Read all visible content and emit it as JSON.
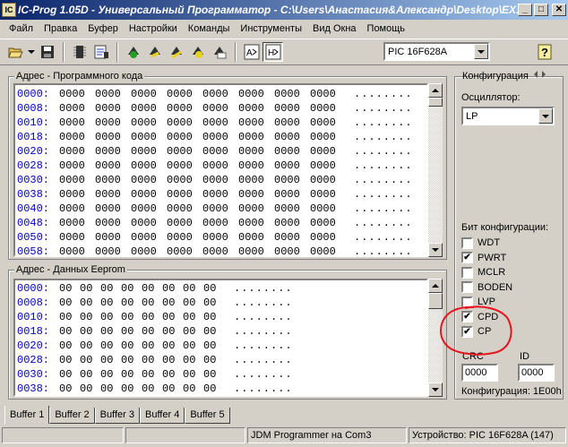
{
  "window": {
    "app_icon_text": "IC",
    "title": "IC-Prog 1.05D - Универсальный Программатор - C:\\Users\\Анастасия&Александр\\Desktop\\EX..."
  },
  "menu": [
    "Файл",
    "Правка",
    "Буфер",
    "Настройки",
    "Команды",
    "Инструменты",
    "Вид Окна",
    "Помощь"
  ],
  "toolbar": {
    "icons": [
      "open-icon",
      "save-icon",
      "chip-icon",
      "chip-config-icon",
      "read-icon",
      "program-icon",
      "erase-icon",
      "verify-icon",
      "blank-check-icon",
      "view-assembler-icon",
      "view-hex-icon",
      "help-icon"
    ],
    "device": "PIC 16F628A"
  },
  "program_memory": {
    "label": "Адрес - Программного кода",
    "rows": [
      {
        "addr": "0000:",
        "cells": [
          "0000",
          "0000",
          "0000",
          "0000",
          "0000",
          "0000",
          "0000",
          "0000"
        ],
        "ascii": "........"
      },
      {
        "addr": "0008:",
        "cells": [
          "0000",
          "0000",
          "0000",
          "0000",
          "0000",
          "0000",
          "0000",
          "0000"
        ],
        "ascii": "........"
      },
      {
        "addr": "0010:",
        "cells": [
          "0000",
          "0000",
          "0000",
          "0000",
          "0000",
          "0000",
          "0000",
          "0000"
        ],
        "ascii": "........"
      },
      {
        "addr": "0018:",
        "cells": [
          "0000",
          "0000",
          "0000",
          "0000",
          "0000",
          "0000",
          "0000",
          "0000"
        ],
        "ascii": "........"
      },
      {
        "addr": "0020:",
        "cells": [
          "0000",
          "0000",
          "0000",
          "0000",
          "0000",
          "0000",
          "0000",
          "0000"
        ],
        "ascii": "........"
      },
      {
        "addr": "0028:",
        "cells": [
          "0000",
          "0000",
          "0000",
          "0000",
          "0000",
          "0000",
          "0000",
          "0000"
        ],
        "ascii": "........"
      },
      {
        "addr": "0030:",
        "cells": [
          "0000",
          "0000",
          "0000",
          "0000",
          "0000",
          "0000",
          "0000",
          "0000"
        ],
        "ascii": "........"
      },
      {
        "addr": "0038:",
        "cells": [
          "0000",
          "0000",
          "0000",
          "0000",
          "0000",
          "0000",
          "0000",
          "0000"
        ],
        "ascii": "........"
      },
      {
        "addr": "0040:",
        "cells": [
          "0000",
          "0000",
          "0000",
          "0000",
          "0000",
          "0000",
          "0000",
          "0000"
        ],
        "ascii": "........"
      },
      {
        "addr": "0048:",
        "cells": [
          "0000",
          "0000",
          "0000",
          "0000",
          "0000",
          "0000",
          "0000",
          "0000"
        ],
        "ascii": "........"
      },
      {
        "addr": "0050:",
        "cells": [
          "0000",
          "0000",
          "0000",
          "0000",
          "0000",
          "0000",
          "0000",
          "0000"
        ],
        "ascii": "........"
      },
      {
        "addr": "0058:",
        "cells": [
          "0000",
          "0000",
          "0000",
          "0000",
          "0000",
          "0000",
          "0000",
          "0000"
        ],
        "ascii": "........"
      }
    ]
  },
  "eeprom": {
    "label": "Адрес - Данных Eeprom",
    "rows": [
      {
        "addr": "0000:",
        "cells": [
          "00",
          "00",
          "00",
          "00",
          "00",
          "00",
          "00",
          "00"
        ],
        "ascii": "........"
      },
      {
        "addr": "0008:",
        "cells": [
          "00",
          "00",
          "00",
          "00",
          "00",
          "00",
          "00",
          "00"
        ],
        "ascii": "........"
      },
      {
        "addr": "0010:",
        "cells": [
          "00",
          "00",
          "00",
          "00",
          "00",
          "00",
          "00",
          "00"
        ],
        "ascii": "........"
      },
      {
        "addr": "0018:",
        "cells": [
          "00",
          "00",
          "00",
          "00",
          "00",
          "00",
          "00",
          "00"
        ],
        "ascii": "........"
      },
      {
        "addr": "0020:",
        "cells": [
          "00",
          "00",
          "00",
          "00",
          "00",
          "00",
          "00",
          "00"
        ],
        "ascii": "........"
      },
      {
        "addr": "0028:",
        "cells": [
          "00",
          "00",
          "00",
          "00",
          "00",
          "00",
          "00",
          "00"
        ],
        "ascii": "........"
      },
      {
        "addr": "0030:",
        "cells": [
          "00",
          "00",
          "00",
          "00",
          "00",
          "00",
          "00",
          "00"
        ],
        "ascii": "........"
      },
      {
        "addr": "0038:",
        "cells": [
          "00",
          "00",
          "00",
          "00",
          "00",
          "00",
          "00",
          "00"
        ],
        "ascii": "........"
      }
    ]
  },
  "config": {
    "title": "Конфигурация",
    "oscillator_label": "Осциллятор:",
    "oscillator": "LP",
    "bits_label": "Бит конфигурации:",
    "bits": [
      {
        "name": "WDT",
        "checked": false
      },
      {
        "name": "PWRT",
        "checked": true
      },
      {
        "name": "MCLR",
        "checked": false
      },
      {
        "name": "BODEN",
        "checked": false
      },
      {
        "name": "LVP",
        "checked": false
      },
      {
        "name": "CPD",
        "checked": true
      },
      {
        "name": "CP",
        "checked": true
      }
    ],
    "check_mark": "✔",
    "crc_label": "CRC",
    "crc": "0000",
    "id_label": "ID",
    "id": "0000",
    "config_word": "Конфигурация: 1E00h",
    "annotation_color": "#e8141e"
  },
  "tabs": [
    "Buffer 1",
    "Buffer 2",
    "Buffer 3",
    "Buffer 4",
    "Buffer 5"
  ],
  "status": {
    "programmer": "JDM Programmer на Com3",
    "device": "Устройство: PIC 16F628A  (147)"
  }
}
